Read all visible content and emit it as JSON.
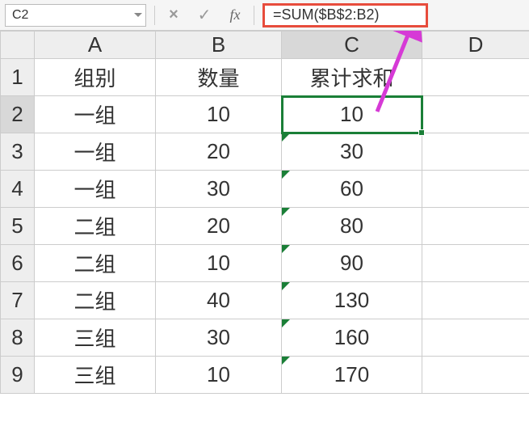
{
  "name_box": "C2",
  "formula": "=SUM($B$2:B2)",
  "columns": [
    "A",
    "B",
    "C",
    "D"
  ],
  "rows": [
    "1",
    "2",
    "3",
    "4",
    "5",
    "6",
    "7",
    "8",
    "9"
  ],
  "header_cells": {
    "A": "组别",
    "B": "数量",
    "C": "累计求和"
  },
  "data": [
    {
      "A": "一组",
      "B": "10",
      "C": "10"
    },
    {
      "A": "一组",
      "B": "20",
      "C": "30"
    },
    {
      "A": "一组",
      "B": "30",
      "C": "60"
    },
    {
      "A": "二组",
      "B": "20",
      "C": "80"
    },
    {
      "A": "二组",
      "B": "10",
      "C": "90"
    },
    {
      "A": "二组",
      "B": "40",
      "C": "130"
    },
    {
      "A": "三组",
      "B": "30",
      "C": "160"
    },
    {
      "A": "三组",
      "B": "10",
      "C": "170"
    }
  ],
  "active_cell": "C2",
  "fb_icons": {
    "cancel": "×",
    "confirm": "✓",
    "fx": "fx"
  }
}
